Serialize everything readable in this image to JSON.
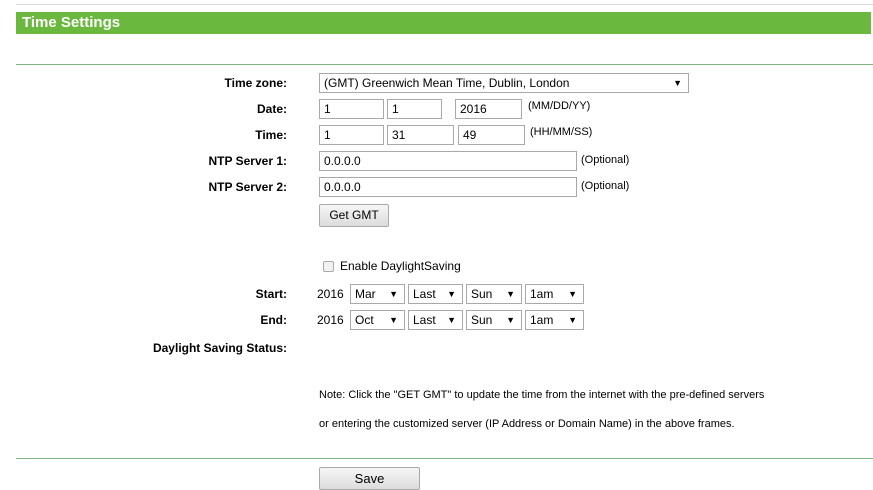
{
  "title": "Time Settings",
  "labels": {
    "timezone": "Time zone:",
    "date": "Date:",
    "time": "Time:",
    "ntp1": "NTP Server 1:",
    "ntp2": "NTP Server 2:",
    "start": "Start:",
    "end": "End:",
    "dst_status": "Daylight Saving Status:"
  },
  "timezone": {
    "selected": "(GMT) Greenwich Mean Time, Dublin, London"
  },
  "date": {
    "month": "1",
    "day": "1",
    "year": "2016",
    "format_hint": "(MM/DD/YY)"
  },
  "time": {
    "hour": "1",
    "minute": "31",
    "second": "49",
    "format_hint": "(HH/MM/SS)"
  },
  "ntp1": {
    "value": "0.0.0.0",
    "hint": "(Optional)"
  },
  "ntp2": {
    "value": "0.0.0.0",
    "hint": "(Optional)"
  },
  "buttons": {
    "get_gmt": "Get GMT",
    "save": "Save"
  },
  "dst": {
    "enable_label": "Enable DaylightSaving",
    "enabled": false,
    "start": {
      "year": "2016",
      "month": "Mar",
      "week": "Last",
      "day": "Sun",
      "hour": "1am"
    },
    "end": {
      "year": "2016",
      "month": "Oct",
      "week": "Last",
      "day": "Sun",
      "hour": "1am"
    }
  },
  "note": {
    "line1": "Note: Click the \"GET GMT\" to update the time from the internet with the pre-defined servers",
    "line2": "or entering the customized server (IP Address or Domain Name) in the above frames."
  }
}
